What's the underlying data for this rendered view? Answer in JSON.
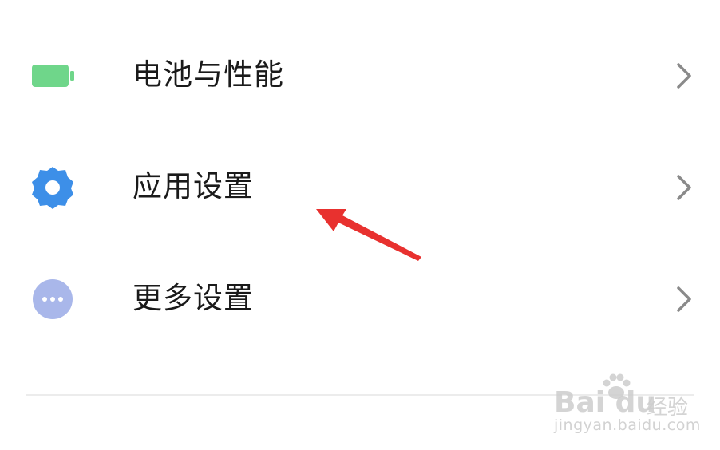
{
  "settings_list": {
    "items": [
      {
        "label": "电池与性能",
        "icon": "battery-icon",
        "icon_color": "#6fd68a"
      },
      {
        "label": "应用设置",
        "icon": "gear-icon",
        "icon_color": "#3d8fe8"
      },
      {
        "label": "更多设置",
        "icon": "more-dots-icon",
        "icon_color": "#a9b7ea"
      }
    ]
  },
  "annotation": {
    "arrow_color": "#e8312f"
  },
  "watermark": {
    "brand": "Bai du",
    "product": "经验",
    "domain": "jingyan.baidu.com"
  },
  "colors": {
    "chevron": "#8a8a8a",
    "text": "#1a1a1a"
  }
}
